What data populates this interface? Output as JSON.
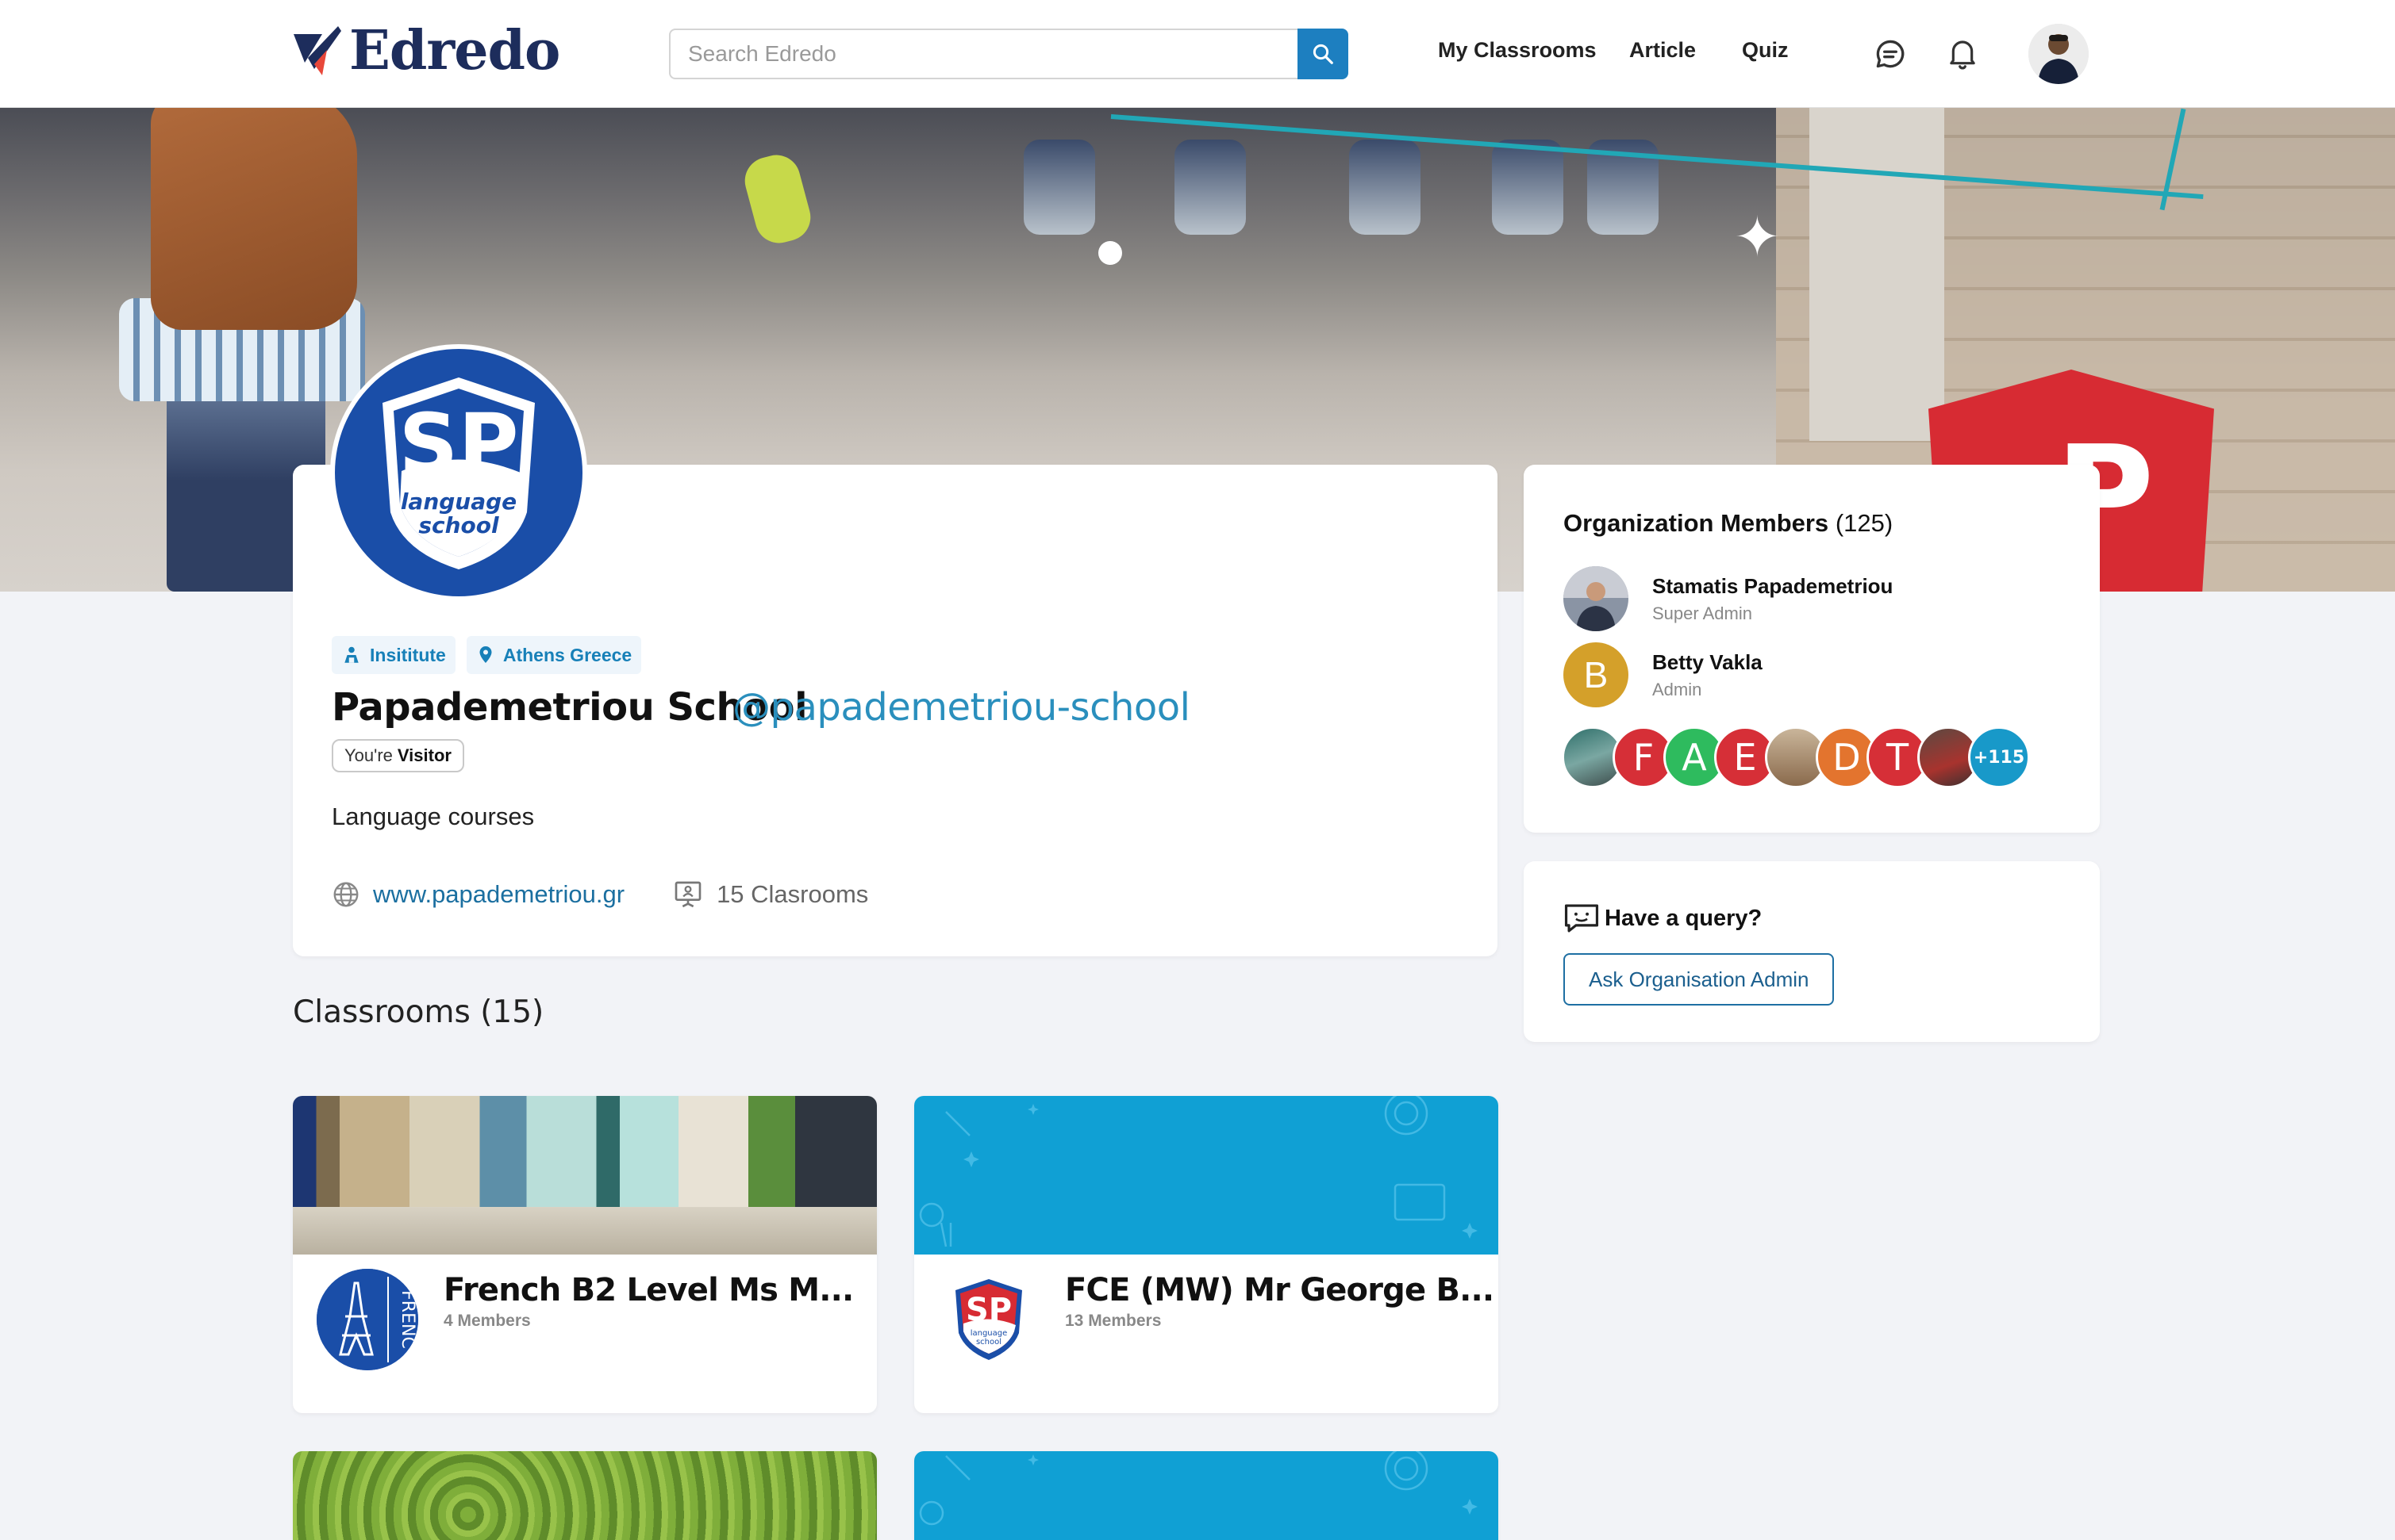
{
  "header": {
    "logo_text": "Edredo",
    "search_placeholder": "Search Edredo",
    "nav": [
      "My Classrooms",
      "Article",
      "Quiz"
    ]
  },
  "org": {
    "logo_letters": "SP",
    "logo_subtitle_1": "language",
    "logo_subtitle_2": "school",
    "type_tag": "Insititute",
    "location_tag": "Athens Greece",
    "name": "Papademetriou School",
    "handle": "@papademetriou-school",
    "visitor_prefix": "You're",
    "visitor_role": "Visitor",
    "description": "Language courses",
    "website": "www.papademetriou.gr",
    "classrooms_count_text": "15 Clasrooms"
  },
  "members": {
    "title": "Organization Members",
    "count_text": "(125)",
    "list": [
      {
        "name": "Stamatis Papademetriou",
        "role": "Super Admin"
      },
      {
        "name": "Betty Vakla",
        "role": "Admin",
        "initial": "B"
      }
    ],
    "stack_initials": [
      "F",
      "A",
      "E",
      "D",
      "T"
    ],
    "more_text": "+115"
  },
  "query": {
    "title": "Have a query?",
    "button": "Ask Organisation Admin"
  },
  "classrooms": {
    "title": "Classrooms (15)",
    "cards": [
      {
        "title": "French B2 Level Ms M...",
        "members": "4 Members",
        "logo_text": "FRENC"
      },
      {
        "title": "FCE (MW) Mr George B...",
        "members": "13 Members",
        "logo_letters": "SP",
        "logo_sub_1": "language",
        "logo_sub_2": "school"
      }
    ]
  },
  "colors": {
    "brand_navy": "#1d2d5c",
    "accent_blue": "#1d7fc0",
    "org_blue": "#1a4ea8",
    "sp_red": "#d72b33",
    "classroom_blue": "#10a0d4"
  }
}
